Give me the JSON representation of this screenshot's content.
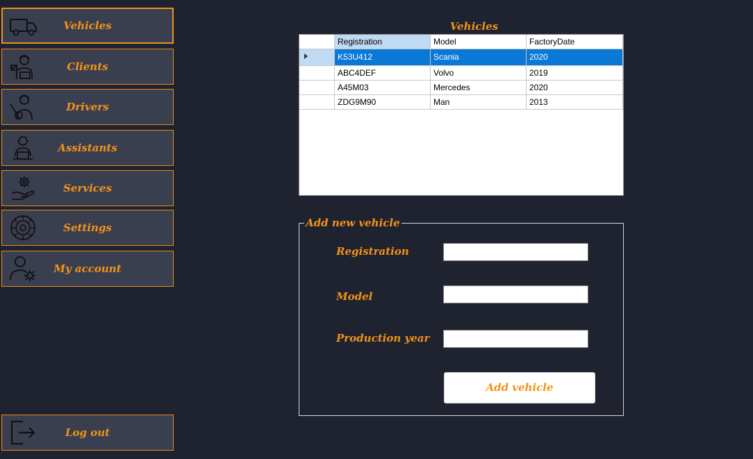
{
  "nav": {
    "items": [
      {
        "label": "Vehicles",
        "icon": "truck-icon"
      },
      {
        "label": "Clients",
        "icon": "client-icon"
      },
      {
        "label": "Drivers",
        "icon": "driver-icon"
      },
      {
        "label": "Assistants",
        "icon": "assistant-icon"
      },
      {
        "label": "Services",
        "icon": "service-gear-hand-icon"
      },
      {
        "label": "Settings",
        "icon": "settings-gear-icon"
      },
      {
        "label": "My account",
        "icon": "user-settings-icon"
      }
    ],
    "logout": {
      "label": "Log out",
      "icon": "logout-icon"
    }
  },
  "grid": {
    "title": "Vehicles",
    "columns": [
      "Registration",
      "Model",
      "FactoryDate"
    ],
    "rows": [
      [
        "K53U412",
        "Scania",
        "2020"
      ],
      [
        "ABC4DEF",
        "Volvo",
        "2019"
      ],
      [
        "A45M03",
        "Mercedes",
        "2020"
      ],
      [
        "ZDG9M90",
        "Man",
        "2013"
      ]
    ],
    "selected_row": 0
  },
  "form": {
    "legend": "Add new vehicle",
    "registration_label": "Registration",
    "model_label": "Model",
    "year_label": "Production year",
    "registration_value": "",
    "model_value": "",
    "year_value": "",
    "submit_label": "Add vehicle"
  },
  "colors": {
    "accent": "#f39318",
    "background": "#1f2330",
    "button_bg": "#3a3f50",
    "selection": "#0a78d7"
  }
}
